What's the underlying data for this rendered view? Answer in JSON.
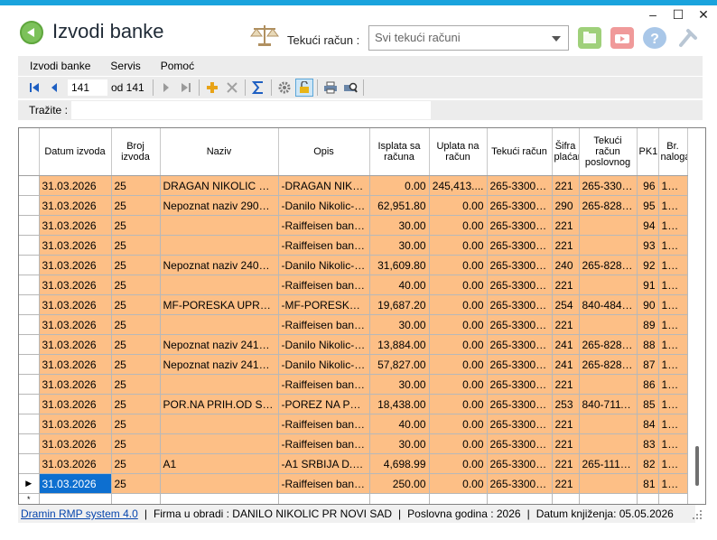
{
  "window": {
    "minimize": "–",
    "maximize": "☐",
    "close": "✕"
  },
  "header": {
    "title": "Izvodi banke",
    "account_label": "Tekući račun :",
    "account_placeholder": "Svi tekući računi"
  },
  "menu": [
    "Izvodi banke",
    "Servis",
    "Pomoć"
  ],
  "toolbar": {
    "record_value": "141",
    "record_of": "od 141"
  },
  "search": {
    "label": "Tražite :",
    "value": ""
  },
  "grid": {
    "columns": [
      "Datum izvoda",
      "Broj izvoda",
      "Naziv",
      "Opis",
      "Isplata sa računa",
      "Uplata na račun",
      "Tekući račun",
      "Šifra plaćanja",
      "Tekući račun poslovnog",
      "PK1",
      "Br. naloga"
    ],
    "rows": [
      [
        "31.03.2026",
        "25",
        "DRAGAN NIKOLIC PR ...",
        "-DRAGAN NIKO...",
        "0.00",
        "245,413....",
        "265-33003...",
        "221",
        "265-3300...",
        "96",
        "100..."
      ],
      [
        "31.03.2026",
        "25",
        "Nepoznat naziv 290858...",
        "-Danilo Nikolic-Dr...",
        "62,951.80",
        "0.00",
        "265-33003...",
        "290",
        "265-8283...",
        "95",
        "100..."
      ],
      [
        "31.03.2026",
        "25",
        "",
        "-Raiffeisen banka...",
        "30.00",
        "0.00",
        "265-33003...",
        "221",
        "",
        "94",
        "100..."
      ],
      [
        "31.03.2026",
        "25",
        "",
        "-Raiffeisen banka...",
        "30.00",
        "0.00",
        "265-33003...",
        "221",
        "",
        "93",
        "100..."
      ],
      [
        "31.03.2026",
        "25",
        "Nepoznat naziv 240858...",
        "-Danilo Nikolic-Z...",
        "31,609.80",
        "0.00",
        "265-33003...",
        "240",
        "265-8283...",
        "92",
        "100..."
      ],
      [
        "31.03.2026",
        "25",
        "",
        "-Raiffeisen banka...",
        "40.00",
        "0.00",
        "265-33003...",
        "221",
        "",
        "91",
        "100..."
      ],
      [
        "31.03.2026",
        "25",
        "MF-PORESKA UPRAVA",
        "-MF-PORESKA U...",
        "19,687.20",
        "0.00",
        "265-33003...",
        "254",
        "840-4848...",
        "90",
        "100..."
      ],
      [
        "31.03.2026",
        "25",
        "",
        "-Raiffeisen banka...",
        "30.00",
        "0.00",
        "265-33003...",
        "221",
        "",
        "89",
        "100..."
      ],
      [
        "31.03.2026",
        "25",
        "Nepoznat naziv 241858...",
        "-Danilo Nikolic-N...",
        "13,884.00",
        "0.00",
        "265-33003...",
        "241",
        "265-8283...",
        "88",
        "100..."
      ],
      [
        "31.03.2026",
        "25",
        "Nepoznat naziv 241858...",
        "-Danilo Nikolic-N...",
        "57,827.00",
        "0.00",
        "265-33003...",
        "241",
        "265-8283...",
        "87",
        "100..."
      ],
      [
        "31.03.2026",
        "25",
        "",
        "-Raiffeisen banka...",
        "30.00",
        "0.00",
        "265-33003...",
        "221",
        "",
        "86",
        "100..."
      ],
      [
        "31.03.2026",
        "25",
        "POR.NA PRIH.OD SA...",
        "-POREZ NA PRI...",
        "18,438.00",
        "0.00",
        "265-33003...",
        "253",
        "840-7111...",
        "85",
        "100..."
      ],
      [
        "31.03.2026",
        "25",
        "",
        "-Raiffeisen banka...",
        "40.00",
        "0.00",
        "265-33003...",
        "221",
        "",
        "84",
        "100..."
      ],
      [
        "31.03.2026",
        "25",
        "",
        "-Raiffeisen banka...",
        "30.00",
        "0.00",
        "265-33003...",
        "221",
        "",
        "83",
        "100..."
      ],
      [
        "31.03.2026",
        "25",
        "A1",
        "-A1 SRBIJA D.O....",
        "4,698.99",
        "0.00",
        "265-33003...",
        "221",
        "265-1110...",
        "82",
        "100..."
      ],
      [
        "31.03.2026",
        "25",
        "",
        "-Raiffeisen banka...",
        "250.00",
        "0.00",
        "265-33003...",
        "221",
        "",
        "81",
        "100..."
      ]
    ],
    "current_row_index": 15,
    "current_marker": "▶",
    "new_row_marker": "*"
  },
  "status": {
    "app_link": "Dramin RMP system 4.0",
    "firm": "Firma u obradi : DANILO NIKOLIC PR NOVI SAD",
    "year": "Poslovna godina : 2026",
    "date": "Datum knjiženja: 05.05.2026"
  },
  "colors": {
    "accent": "#1aa3dd",
    "row_bg": "#fdbf86",
    "selection": "#0d6fd0"
  }
}
